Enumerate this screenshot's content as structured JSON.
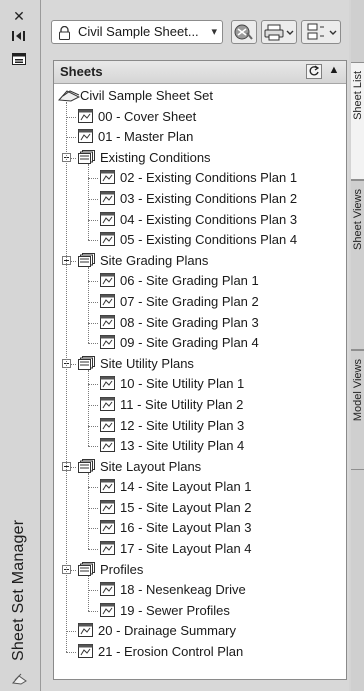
{
  "palette": {
    "title": "Sheet Set Manager"
  },
  "toolbar": {
    "sheet_set_value": "Civil Sample Sheet..."
  },
  "panel": {
    "title": "Sheets"
  },
  "tabs": [
    "Sheet List",
    "Sheet Views",
    "Model Views"
  ],
  "tree": [
    {
      "label": "Civil Sample Sheet Set",
      "type": "root"
    },
    {
      "label": "00 - Cover Sheet",
      "type": "sheet",
      "level": 1
    },
    {
      "label": "01 - Master Plan",
      "type": "sheet",
      "level": 1
    },
    {
      "label": "Existing Conditions",
      "type": "group",
      "level": 1
    },
    {
      "label": "02 - Existing Conditions Plan 1",
      "type": "sheet",
      "level": 2
    },
    {
      "label": "03 - Existing Conditions Plan 2",
      "type": "sheet",
      "level": 2
    },
    {
      "label": "04 - Existing Conditions Plan 3",
      "type": "sheet",
      "level": 2
    },
    {
      "label": "05 - Existing Conditions Plan 4",
      "type": "sheet",
      "level": 2
    },
    {
      "label": "Site Grading Plans",
      "type": "group",
      "level": 1
    },
    {
      "label": "06 - Site Grading Plan 1",
      "type": "sheet",
      "level": 2
    },
    {
      "label": "07 - Site Grading Plan 2",
      "type": "sheet",
      "level": 2
    },
    {
      "label": "08 - Site Grading Plan 3",
      "type": "sheet",
      "level": 2
    },
    {
      "label": "09 - Site Grading Plan 4",
      "type": "sheet",
      "level": 2
    },
    {
      "label": "Site Utility Plans",
      "type": "group",
      "level": 1
    },
    {
      "label": "10 - Site Utility Plan 1",
      "type": "sheet",
      "level": 2
    },
    {
      "label": "11 - Site Utility Plan 2",
      "type": "sheet",
      "level": 2
    },
    {
      "label": "12 - Site Utility Plan 3",
      "type": "sheet",
      "level": 2
    },
    {
      "label": "13 - Site Utility Plan 4",
      "type": "sheet",
      "level": 2
    },
    {
      "label": "Site Layout Plans",
      "type": "group",
      "level": 1
    },
    {
      "label": "14 - Site Layout Plan 1",
      "type": "sheet",
      "level": 2
    },
    {
      "label": "15 - Site Layout Plan 2",
      "type": "sheet",
      "level": 2
    },
    {
      "label": "16 - Site Layout Plan 3",
      "type": "sheet",
      "level": 2
    },
    {
      "label": "17 - Site Layout Plan 4",
      "type": "sheet",
      "level": 2
    },
    {
      "label": "Profiles",
      "type": "group",
      "level": 1
    },
    {
      "label": "18 - Nesenkeag Drive",
      "type": "sheet",
      "level": 2
    },
    {
      "label": "19 - Sewer Profiles",
      "type": "sheet",
      "level": 2
    },
    {
      "label": "20 - Drainage Summary",
      "type": "sheet",
      "level": 1
    },
    {
      "label": "21 - Erosion Control Plan",
      "type": "sheet",
      "level": 1
    }
  ],
  "icons": {
    "close": "close-icon",
    "autohide": "autohide-icon",
    "properties": "properties-icon",
    "refresh": "refresh-icon",
    "collapse": "collapse-up-icon"
  }
}
